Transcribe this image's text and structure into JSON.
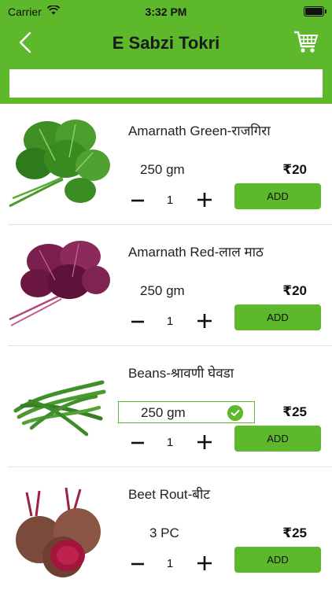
{
  "status_bar": {
    "carrier": "Carrier",
    "time": "3:32 PM"
  },
  "header": {
    "title": "E Sabzi Tokri"
  },
  "search": {
    "placeholder": "",
    "value": ""
  },
  "colors": {
    "brand": "#5db82b",
    "text": "#222222",
    "divider": "#e2e2e2"
  },
  "products": [
    {
      "name": "Amarnath Green-राजगिरा",
      "weight": "250 gm",
      "price": "₹20",
      "quantity": "1",
      "add_label": "ADD",
      "weight_selected": false
    },
    {
      "name": "Amarnath Red-लाल माठ",
      "weight": "250 gm",
      "price": "₹20",
      "quantity": "1",
      "add_label": "ADD",
      "weight_selected": false
    },
    {
      "name": "Beans-श्रावणी घेवडा",
      "weight": "250 gm",
      "price": "₹25",
      "quantity": "1",
      "add_label": "ADD",
      "weight_selected": true
    },
    {
      "name": "Beet Rout-बीट",
      "weight": "3 PC",
      "price": "₹25",
      "quantity": "1",
      "add_label": "ADD",
      "weight_selected": false
    }
  ]
}
